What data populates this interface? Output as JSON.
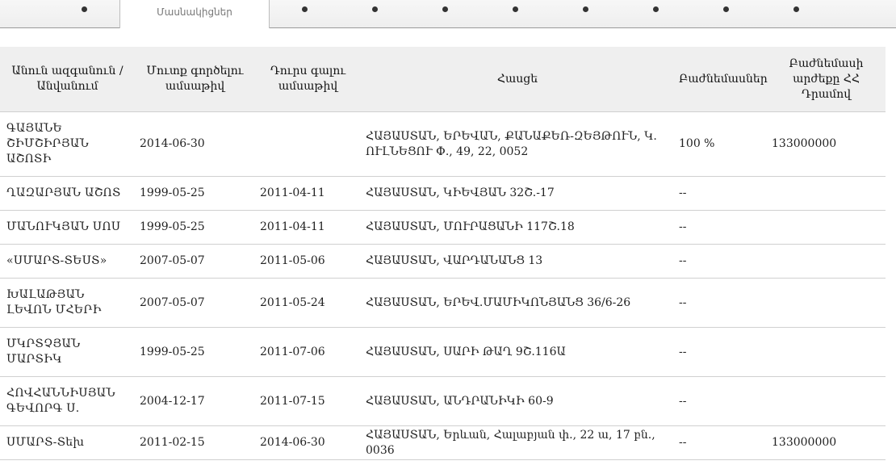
{
  "tabs": {
    "active_label": "Մասնակիցներ"
  },
  "table": {
    "headers": {
      "name": "Անուն ազգանուն / Անվանում",
      "join_date": "Մուտք գործելու ամսաթիվ",
      "exit_date": "Դուրս գալու ամսաթիվ",
      "address": "Հասցե",
      "shares": "Բաժնեմասներ",
      "share_value": "Բաժնեմասի արժեքը ՀՀ Դրամով"
    },
    "rows": [
      {
        "name": "ԳԱՅԱՆԵ ՇԻՄՇԻՐՅԱՆ ԱՇՈՏԻ",
        "join": "2014-06-30",
        "exit": "",
        "address": "ՀԱՅԱՍՏԱՆ, ԵՐԵՎԱՆ, ՔԱՆԱՔԵՌ-ԶԵՅԹՈՒՆ, Կ. ՈՒԼՆԵՑՈՒ Փ., 49, 22, 0052",
        "shares": "100 %",
        "value": "133000000"
      },
      {
        "name": "ՂԱԶԱՐՅԱՆ ԱՇՈՏ",
        "join": "1999-05-25",
        "exit": "2011-04-11",
        "address": "ՀԱՅԱՍՏԱՆ, ԿԻԵՎՅԱՆ 32Շ.-17",
        "shares": "--",
        "value": ""
      },
      {
        "name": "ՄԱՆՈՒԿՅԱՆ ՍՈՍ",
        "join": "1999-05-25",
        "exit": "2011-04-11",
        "address": "ՀԱՅԱՍՏԱՆ, ՄՈՒՐԱՑԱՆԻ 117Շ.18",
        "shares": "--",
        "value": ""
      },
      {
        "name": "«ՍՄԱՐՏ-ՏԵՍՏ»",
        "join": "2007-05-07",
        "exit": "2011-05-06",
        "address": "ՀԱՅԱՍՏԱՆ, ՎԱՐԴԱՆԱՆՑ 13",
        "shares": "--",
        "value": ""
      },
      {
        "name": "ԽԱԼԱԹՅԱՆ ԼԵՎՈՆ ՄՀԵՐԻ",
        "join": "2007-05-07",
        "exit": "2011-05-24",
        "address": "ՀԱՅԱՍՏԱՆ, ԵՐԵՎ.ՄԱՄԻԿՈՆՅԱՆՑ 36/6-26",
        "shares": "--",
        "value": ""
      },
      {
        "name": "ՄԿՐՏՉՅԱՆ ՄԱՐՏԻԿ",
        "join": "1999-05-25",
        "exit": "2011-07-06",
        "address": "ՀԱՅԱՍՏԱՆ, ՍԱՐԻ ԹԱՂ 9Շ.116Ա",
        "shares": "--",
        "value": ""
      },
      {
        "name": "ՀՈՎՀԱՆՆԻՍՅԱՆ ԳԵՎՈՐԳ Ս.",
        "join": "2004-12-17",
        "exit": "2011-07-15",
        "address": "ՀԱՅԱՍՏԱՆ, ԱՆԴՐԱՆԻԿԻ 60-9",
        "shares": "--",
        "value": ""
      },
      {
        "name": "ՍՄԱՐՏ-Տեխ",
        "join": "2011-02-15",
        "exit": "2014-06-30",
        "address": "ՀԱՅԱՍՏԱՆ, Երևան, Հալաբյան փ., 22 ա, 17 բն., 0036",
        "shares": "--",
        "value": "133000000"
      }
    ]
  }
}
